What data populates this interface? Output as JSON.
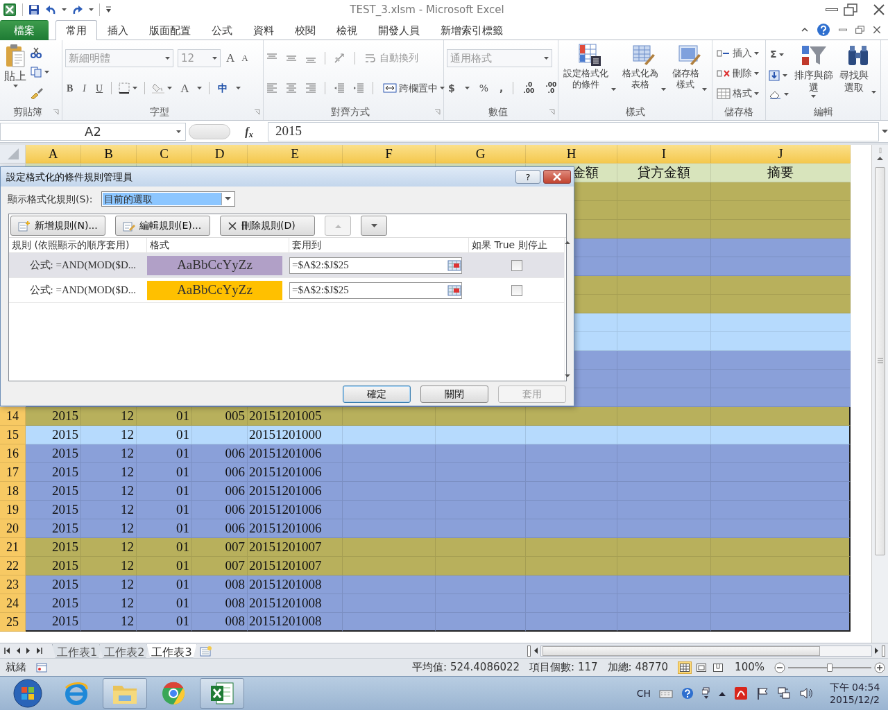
{
  "window": {
    "title": "TEST_3.xlsm  -  Microsoft Excel"
  },
  "ribbon_tabs": [
    {
      "label": "檔案",
      "kind": "file",
      "selected": false
    },
    {
      "label": "常用",
      "kind": "tab",
      "selected": true
    },
    {
      "label": "插入",
      "kind": "tab",
      "selected": false
    },
    {
      "label": "版面配置",
      "kind": "tab",
      "selected": false
    },
    {
      "label": "公式",
      "kind": "tab",
      "selected": false
    },
    {
      "label": "資料",
      "kind": "tab",
      "selected": false
    },
    {
      "label": "校閱",
      "kind": "tab",
      "selected": false
    },
    {
      "label": "檢視",
      "kind": "tab",
      "selected": false
    },
    {
      "label": "開發人員",
      "kind": "tab",
      "selected": false
    },
    {
      "label": "新增索引標籤",
      "kind": "tab",
      "selected": false
    }
  ],
  "ribbon": {
    "clipboard": {
      "paste": "貼上",
      "label": "剪貼簿"
    },
    "font": {
      "family": "新細明體",
      "size": "12",
      "grow": "A",
      "shrink": "A",
      "bold": "B",
      "italic": "I",
      "underline": "U",
      "font_color": "A",
      "phonetic": "中",
      "label": "字型"
    },
    "alignment": {
      "wrap_text": "自動換列",
      "merge_center": "跨欄置中",
      "label": "對齊方式"
    },
    "number": {
      "format": "通用格式",
      "currency": "$",
      "percent": "%",
      "comma": ",",
      "decimal_increase": ".0\n.00",
      "decimal_decrease": ".00\n.0",
      "label": "數值"
    },
    "styles": {
      "conditional": "設定格式化的條件",
      "as_table": "格式化為表格",
      "cell_styles": "儲存格樣式",
      "label": "樣式"
    },
    "cells": {
      "insert": "插入",
      "delete": "刪除",
      "format": "格式",
      "label": "儲存格"
    },
    "editing": {
      "sum": "Σ",
      "sort_filter": "排序與篩選",
      "find_select": "尋找與選取",
      "label": "編輯"
    }
  },
  "formula_bar": {
    "name_box": "A2",
    "function_label": "f$_{x}$",
    "value": "2015"
  },
  "sheet": {
    "columns": [
      {
        "label": "A",
        "selected": true
      },
      {
        "label": "B",
        "selected": true
      },
      {
        "label": "C",
        "selected": true
      },
      {
        "label": "D",
        "selected": true
      },
      {
        "label": "E",
        "selected": true
      },
      {
        "label": "F",
        "selected": true
      },
      {
        "label": "G",
        "selected": true
      },
      {
        "label": "H",
        "selected": true
      },
      {
        "label": "I",
        "selected": true
      },
      {
        "label": "J",
        "selected": true
      }
    ],
    "rows": [
      {
        "color": "#d8e4bc",
        "cells": {
          "H": "金額",
          "I": "貸方金額",
          "J": "摘要"
        }
      },
      {
        "color": "#b8b05c"
      },
      {
        "color": "#b8b05c"
      },
      {
        "color": "#b8b05c"
      },
      {
        "color": "#8aa0d9"
      },
      {
        "color": "#8aa0d9"
      },
      {
        "color": "#b8b05c"
      },
      {
        "color": "#b8b05c"
      },
      {
        "color": "#b6dafd"
      },
      {
        "color": "#b6dafd"
      },
      {
        "color": "#8aa0d9"
      },
      {
        "color": "#8aa0d9"
      },
      {
        "color": "#8aa0d9"
      },
      {
        "number": "14",
        "selected": true,
        "color": "#b8b05c",
        "cells": {
          "A": "2015",
          "B": "12",
          "C": "01",
          "D": "005",
          "E": "20151201005"
        }
      },
      {
        "number": "15",
        "selected": true,
        "color": "#b6dafd",
        "cells": {
          "A": "2015",
          "B": "12",
          "C": "01",
          "E": "20151201000"
        }
      },
      {
        "number": "16",
        "selected": true,
        "color": "#8aa0d9",
        "cells": {
          "A": "2015",
          "B": "12",
          "C": "01",
          "D": "006",
          "E": "20151201006"
        }
      },
      {
        "number": "17",
        "selected": true,
        "color": "#8aa0d9",
        "cells": {
          "A": "2015",
          "B": "12",
          "C": "01",
          "D": "006",
          "E": "20151201006"
        }
      },
      {
        "number": "18",
        "selected": true,
        "color": "#8aa0d9",
        "cells": {
          "A": "2015",
          "B": "12",
          "C": "01",
          "D": "006",
          "E": "20151201006"
        }
      },
      {
        "number": "19",
        "selected": true,
        "color": "#8aa0d9",
        "cells": {
          "A": "2015",
          "B": "12",
          "C": "01",
          "D": "006",
          "E": "20151201006"
        }
      },
      {
        "number": "20",
        "selected": true,
        "color": "#8aa0d9",
        "cells": {
          "A": "2015",
          "B": "12",
          "C": "01",
          "D": "006",
          "E": "20151201006"
        }
      },
      {
        "number": "21",
        "selected": true,
        "color": "#b8b05c",
        "cells": {
          "A": "2015",
          "B": "12",
          "C": "01",
          "D": "007",
          "E": "20151201007"
        }
      },
      {
        "number": "22",
        "selected": true,
        "color": "#b8b05c",
        "cells": {
          "A": "2015",
          "B": "12",
          "C": "01",
          "D": "007",
          "E": "20151201007"
        }
      },
      {
        "number": "23",
        "selected": true,
        "color": "#8aa0d9",
        "cells": {
          "A": "2015",
          "B": "12",
          "C": "01",
          "D": "008",
          "E": "20151201008"
        }
      },
      {
        "number": "24",
        "selected": true,
        "color": "#8aa0d9",
        "cells": {
          "A": "2015",
          "B": "12",
          "C": "01",
          "D": "008",
          "E": "20151201008"
        }
      },
      {
        "number": "25",
        "selected": true,
        "color": "#8aa0d9",
        "cells": {
          "A": "2015",
          "B": "12",
          "C": "01",
          "D": "008",
          "E": "20151201008"
        }
      }
    ]
  },
  "sheet_tabs": [
    {
      "label": "工作表1",
      "selected": false
    },
    {
      "label": "工作表2",
      "selected": false
    },
    {
      "label": "工作表3",
      "selected": true
    }
  ],
  "status_bar": {
    "ready": "就緒",
    "average": "平均值: 524.4086022",
    "count": "項目個數: 117",
    "sum": "加總: 48770",
    "zoom": "100%",
    "zoom_slider": {
      "level": 0.5
    }
  },
  "taskbar": {
    "language": "CH",
    "time": "下午 04:54",
    "date": "2015/12/2"
  },
  "dialog": {
    "title": "設定格式化的條件規則管理員",
    "help": "?",
    "show_label": "顯示格式化規則(S):",
    "show_value": "目前的選取",
    "buttons": [
      "新增規則(N)...",
      "編輯規則(E)...",
      "刪除規則(D)"
    ],
    "move_up": {
      "disabled": true
    },
    "move_down": {
      "disabled": false
    },
    "columns": [
      "規則 (依照顯示的順序套用)",
      "格式",
      "套用到",
      "如果 True 則停止"
    ],
    "rules": [
      {
        "rule": "公式: =AND(MOD($D...",
        "preview": "AaBbCcYyZz",
        "color": "#b1a0c7",
        "applies_to": "=$A$2:$J$25",
        "stop_if_true": false,
        "selected": true
      },
      {
        "rule": "公式: =AND(MOD($D...",
        "preview": "AaBbCcYyZz",
        "color": "#ffc000",
        "applies_to": "=$A$2:$J$25",
        "stop_if_true": false,
        "selected": false
      }
    ],
    "footer": [
      {
        "label": "確定",
        "default": true,
        "disabled": false
      },
      {
        "label": "關閉",
        "default": false,
        "disabled": false
      },
      {
        "label": "套用",
        "default": false,
        "disabled": true
      }
    ]
  }
}
